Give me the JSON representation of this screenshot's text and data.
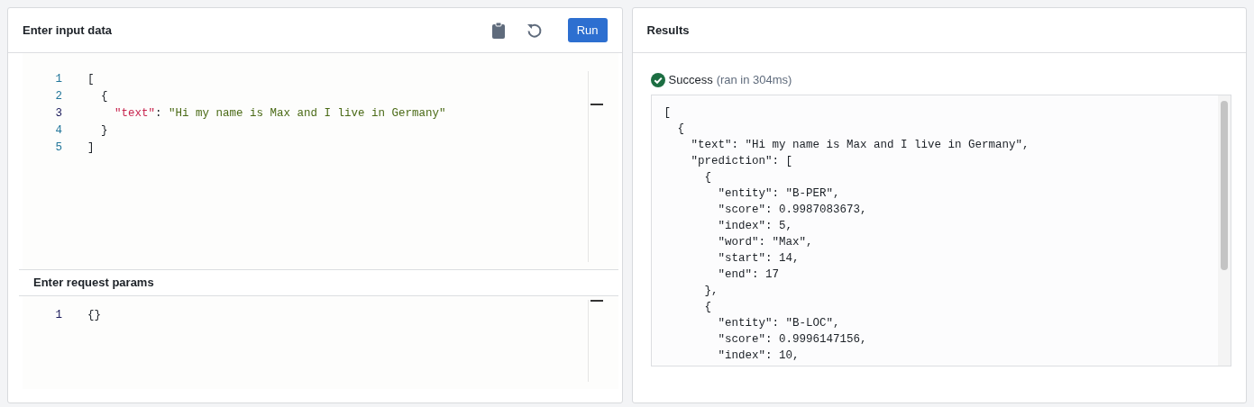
{
  "input_panel": {
    "title": "Enter input data",
    "buttons": [
      {
        "kind": "clipboard"
      },
      {
        "kind": "reset"
      },
      {
        "kind": "run",
        "label": "Run"
      }
    ],
    "editor": {
      "lines": [
        {
          "number": "1",
          "current": false,
          "tokens": [
            {
              "text": "["
            }
          ]
        },
        {
          "number": "2",
          "current": false,
          "tokens": [
            {
              "text": "  {"
            }
          ]
        },
        {
          "number": "3",
          "current": true,
          "tokens": [
            {
              "kind": "key",
              "text": "    \"text\""
            },
            {
              "text": ": "
            },
            {
              "kind": "string",
              "text": "\"Hi my name is Max and I live in Germany\""
            }
          ]
        },
        {
          "number": "4",
          "current": false,
          "tokens": [
            {
              "text": "  }"
            }
          ]
        },
        {
          "number": "5",
          "current": false,
          "tokens": [
            {
              "text": "]"
            }
          ]
        }
      ]
    }
  },
  "params_panel": {
    "title": "Enter request params",
    "editor": {
      "lines": [
        {
          "number": "1",
          "current": true,
          "tokens": [
            {
              "text": "{}"
            }
          ]
        }
      ]
    }
  },
  "results_panel": {
    "title": "Results",
    "status": {
      "kind": "success",
      "label": "Success",
      "detail": "(ran in 304ms)"
    },
    "output": [
      "[",
      "  {",
      "    \"text\": \"Hi my name is Max and I live in Germany\",",
      "    \"prediction\": [",
      "      {",
      "        \"entity\": \"B-PER\",",
      "        \"score\": 0.9987083673,",
      "        \"index\": 5,",
      "        \"word\": \"Max\",",
      "        \"start\": 14,",
      "        \"end\": 17",
      "      },",
      "      {",
      "        \"entity\": \"B-LOC\",",
      "        \"score\": 0.9996147156,",
      "        \"index\": 10,"
    ]
  }
}
